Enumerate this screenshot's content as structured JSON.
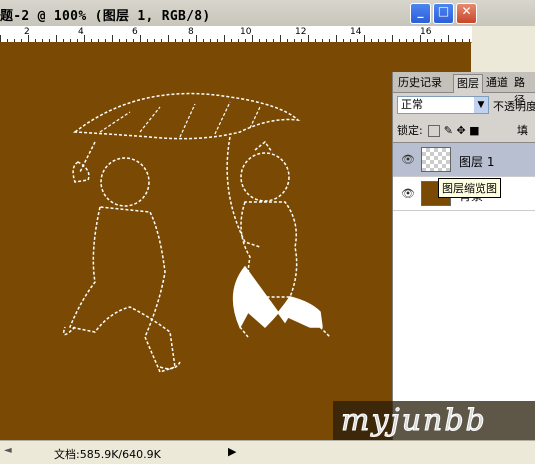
{
  "window": {
    "title": "题-2 @ 100% (图层 1, RGB/8)",
    "min_glyph": "_",
    "max_glyph": "□",
    "close_glyph": "✕"
  },
  "ruler": {
    "labels": [
      "2",
      "4",
      "6",
      "8",
      "10",
      "12",
      "14",
      "16"
    ]
  },
  "canvas": {
    "background": "#7a4a05"
  },
  "status": {
    "doc_info": "文档:585.9K/640.9K",
    "arrow": "▶",
    "left_glyph": "◄"
  },
  "panel": {
    "tabs": [
      "历史记录",
      "图层",
      "通道",
      "路径"
    ],
    "blend_mode": "正常",
    "opacity_label": "不透明度",
    "lock_label": "锁定:",
    "fill_label": "填",
    "layers": [
      {
        "name": "图层 1",
        "thumb": "transparent",
        "selected": true
      },
      {
        "name": "背景",
        "thumb": "brown",
        "selected": false
      }
    ]
  },
  "tooltip": {
    "text": "图层缩览图"
  },
  "watermark": {
    "text": "myjunbb"
  },
  "icons": [
    "eye-icon",
    "lock-icon",
    "move-icon",
    "brush-icon",
    "transparency-icon"
  ]
}
